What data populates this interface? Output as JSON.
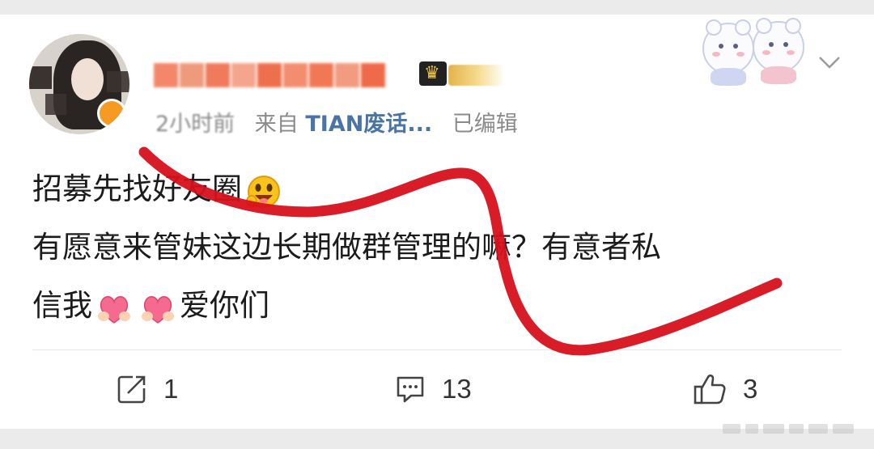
{
  "post": {
    "meta": {
      "time": "2小时前",
      "from_prefix": "来自",
      "source": "TIAN废话...",
      "edited": "已编辑"
    },
    "content": {
      "line1": "招募先找好友圈",
      "line2": "有愿意来管妹这边长期做群管理的嘛？有意者私",
      "line3_start": "信我",
      "line3_end": "爱你们"
    },
    "emojis": [
      "grin-face-icon",
      "heart-hug-icon",
      "heart-hug-icon"
    ]
  },
  "actions": {
    "repost_count": "1",
    "comment_count": "13",
    "like_count": "3"
  },
  "colors": {
    "username": "#f06a3a",
    "source_link": "#4a74a6",
    "meta_text": "#8a8a8a",
    "scribble": "#d6101c"
  }
}
